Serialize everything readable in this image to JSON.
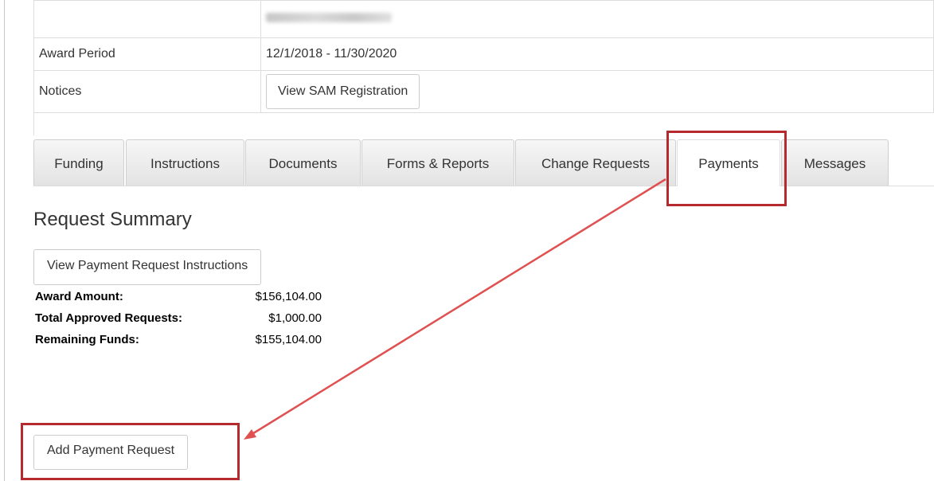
{
  "info": {
    "award_period_label": "Award Period",
    "award_period_value": "12/1/2018 - 11/30/2020",
    "notices_label": "Notices",
    "sam_button": "View SAM Registration"
  },
  "tabs": [
    {
      "label": "Funding"
    },
    {
      "label": "Instructions"
    },
    {
      "label": "Documents"
    },
    {
      "label": "Forms & Reports"
    },
    {
      "label": "Change Requests"
    },
    {
      "label": "Payments",
      "active": true
    },
    {
      "label": "Messages"
    }
  ],
  "summary": {
    "title": "Request Summary",
    "instructions_button": "View Payment Request Instructions",
    "rows": [
      {
        "label": "Award Amount:",
        "value": "$156,104.00"
      },
      {
        "label": "Total Approved Requests:",
        "value": "$1,000.00"
      },
      {
        "label": "Remaining Funds:",
        "value": "$155,104.00"
      }
    ],
    "add_button": "Add Payment Request"
  },
  "colors": {
    "highlight": "#b52a2e",
    "arrow": "#e05050"
  }
}
